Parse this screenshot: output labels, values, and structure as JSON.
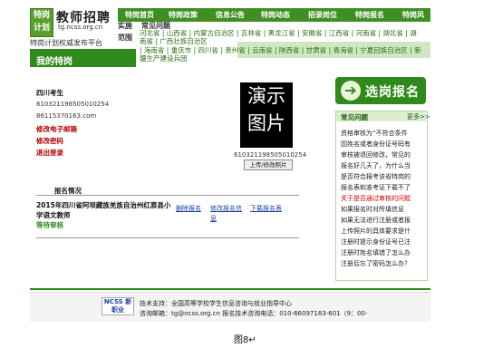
{
  "header": {
    "logo_text": "特岗计划",
    "brand": "教师招聘",
    "url": "tg.ncss.org.cn",
    "tagline": "特岗计划权威发布平台"
  },
  "nav": [
    "特岗首页",
    "特岗政策",
    "信息公告",
    "特岗动态",
    "招录岗位",
    "特岗报名",
    "特岗风"
  ],
  "province_menu": {
    "left_badges": [
      "实施",
      "范围"
    ],
    "title": "常见问题",
    "lines": [
      "河北省 | 山西省 | 内蒙古自治区 | 吉林省 | 黑龙江省 | 安徽省 | 江西省 | 河南省 | 湖北省 | 湖",
      "南省 | 广西壮族自治区",
      "| 海南省 | 重庆市 | 四川省 | 贵州省 | 云南省 | 陕西省 | 甘肃省 | 青海省 | 宁夏回族自治区 | 新",
      "疆生产建设兵团"
    ]
  },
  "banner": {
    "title": "我的特岗"
  },
  "profile": {
    "name": "四川考生",
    "id_number": "610321198505010254",
    "email": "86115370163.com",
    "links": [
      "修改电子邮箱",
      "修改密码",
      "退出登录"
    ],
    "photo_text": "演示图片",
    "photo_id": "610321198505010254",
    "upload_label": "上传/修改照片"
  },
  "report": {
    "title": "报名情况",
    "job_name": "2015年四川省阿坝藏族羌族自治州红原县小学语文教师",
    "status": "等待审核",
    "actions": [
      "删除报名",
      "修改报名信息",
      "下载报名表"
    ]
  },
  "apply_button": {
    "icon": "arrow-right-icon",
    "label": "选岗报名"
  },
  "faq": {
    "title": "常见问题",
    "more": "更多>>",
    "items": [
      {
        "text": "资格审核为“不符合条件",
        "highlight": false
      },
      {
        "text": "因姓名或者身份证号码有",
        "highlight": false
      },
      {
        "text": "审核被退回修改，常见的",
        "highlight": false
      },
      {
        "text": "报名好几天了，为什么当",
        "highlight": false
      },
      {
        "text": "是否符合报考该省特岗的",
        "highlight": false
      },
      {
        "text": "报名表和准考证下载不了",
        "highlight": false
      },
      {
        "text": "关于是否通过审核的问题",
        "highlight": true
      },
      {
        "text": "如果报名时对所填信息",
        "highlight": false
      },
      {
        "text": "如果无法进行注册或者报",
        "highlight": false
      },
      {
        "text": "上传照片的具体要求是什",
        "highlight": false
      },
      {
        "text": "注册时提示身份证号已注",
        "highlight": false
      },
      {
        "text": "注册时姓名填错了怎么办",
        "highlight": false
      },
      {
        "text": "注册后忘了密码怎么办？",
        "highlight": false
      }
    ]
  },
  "footer": {
    "logo_text": "NCSS 新职业",
    "line1": "技术支持：全国高等学校学生信息咨询与就业指导中心",
    "line2": "咨询邮箱：tg@ncss.org.cn 报名技术咨询电话：010-66097183-601（9：00-"
  },
  "caption": "图8↵",
  "colors": {
    "green": "#2f8a1b",
    "light_green": "#dceecf",
    "red": "#d10000"
  }
}
